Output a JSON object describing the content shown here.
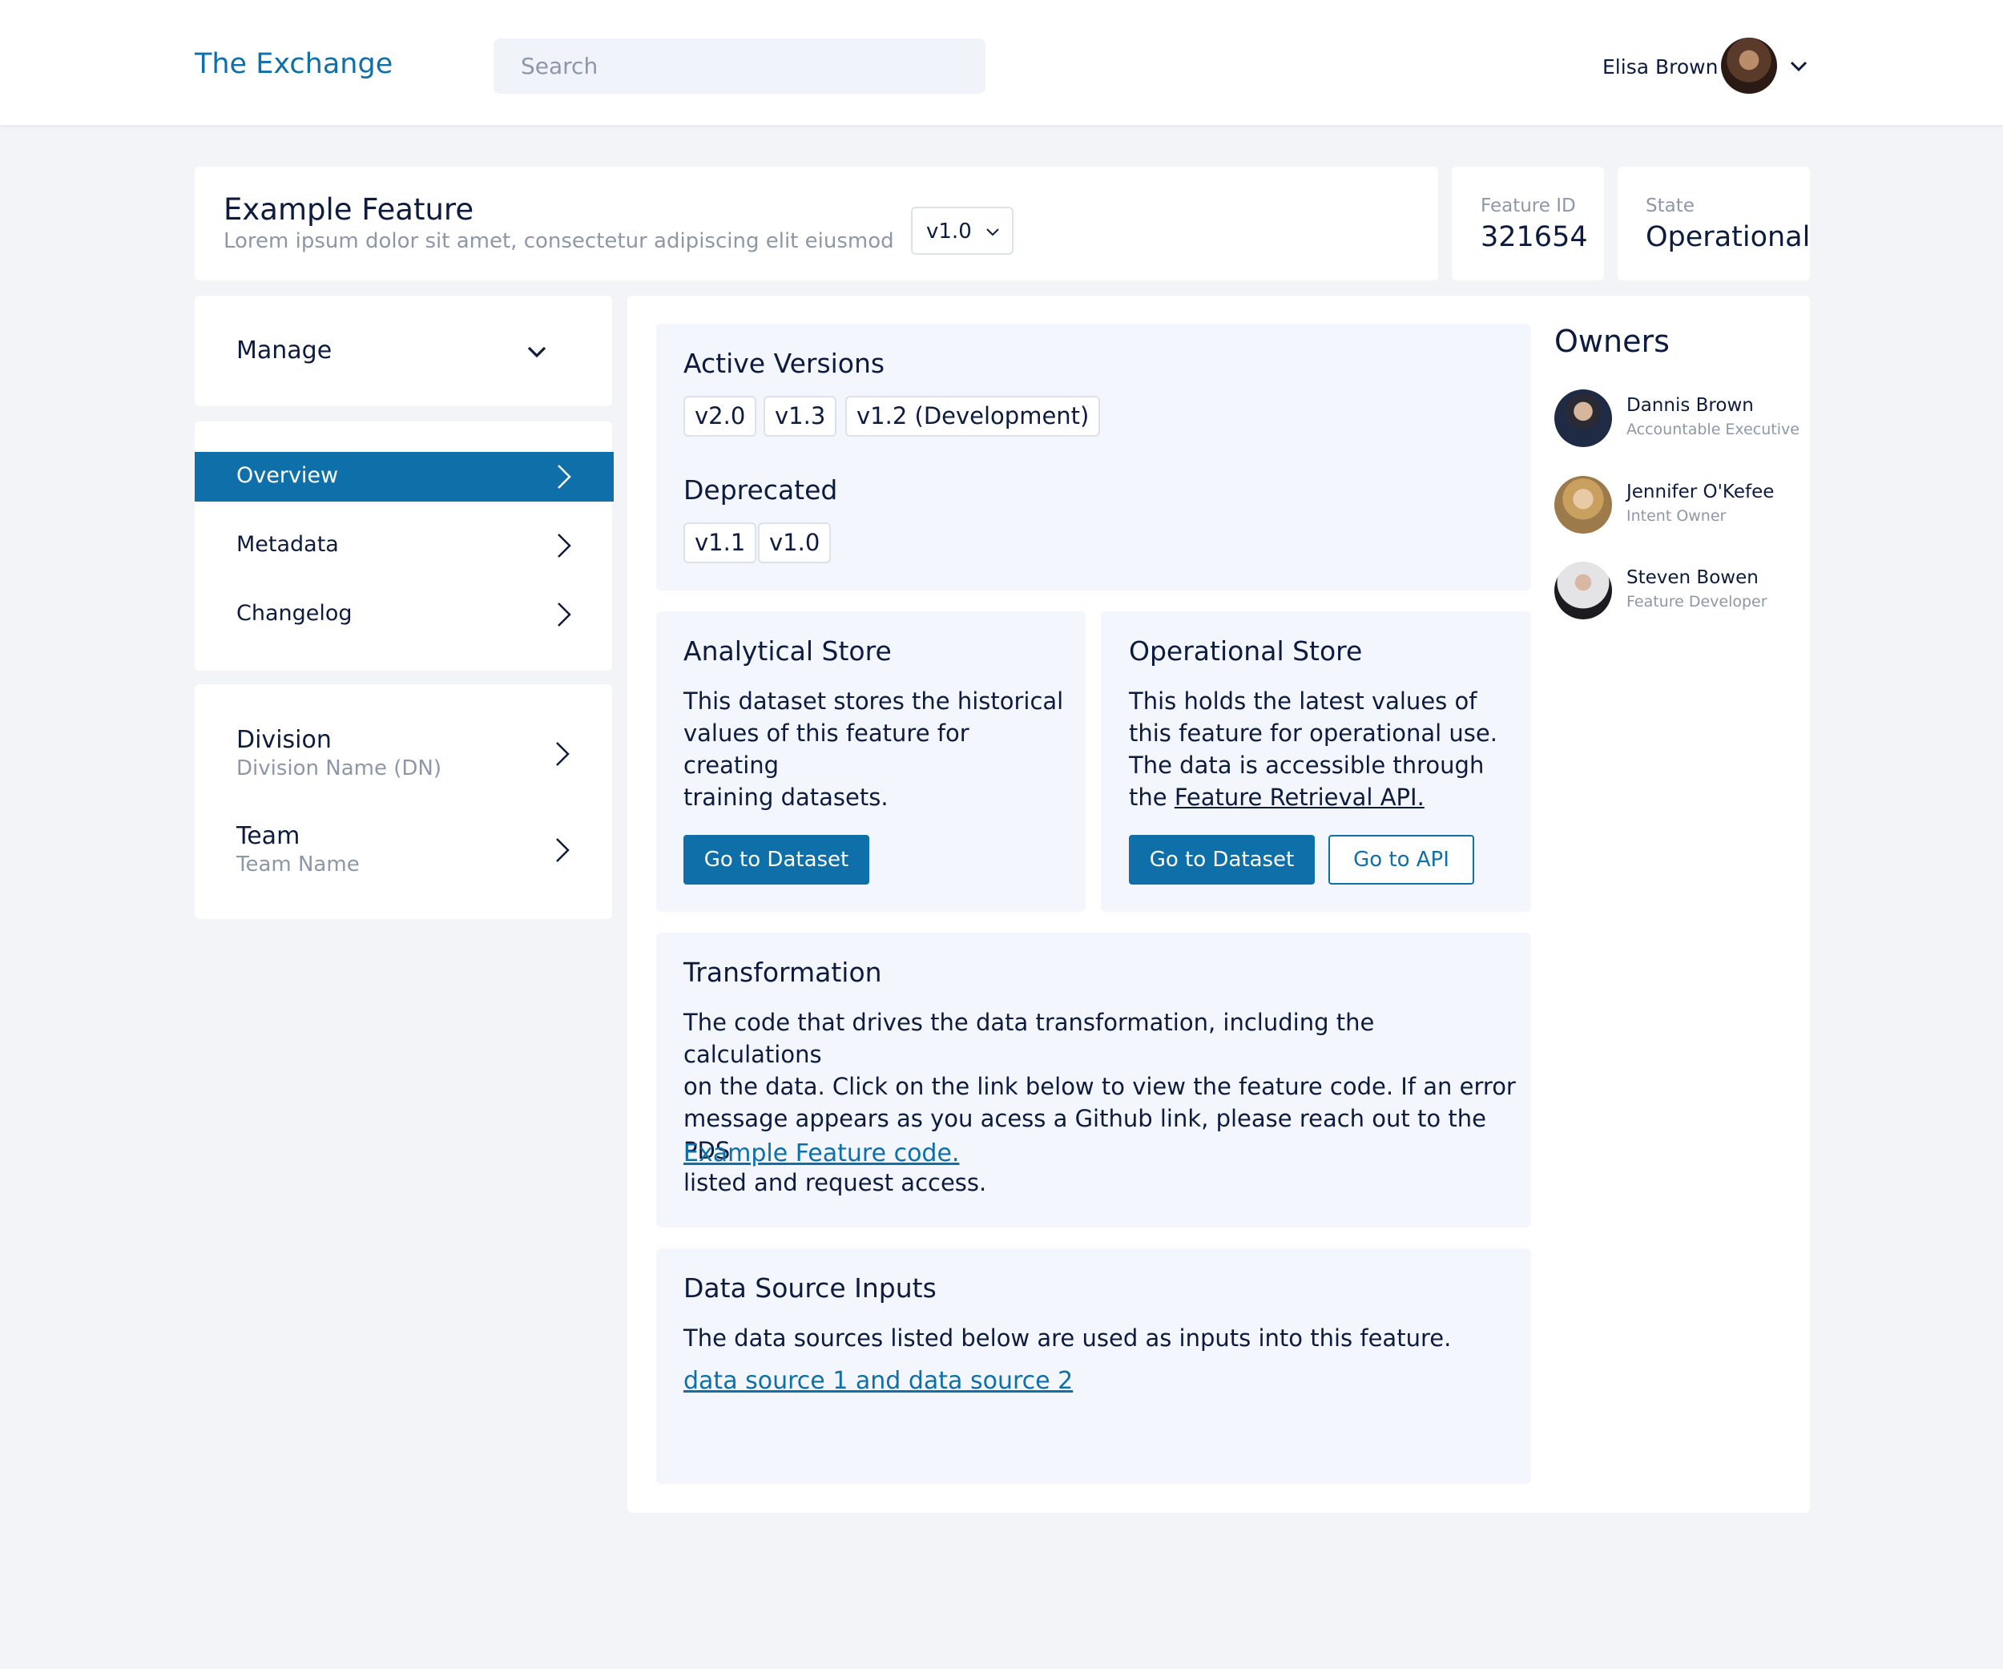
{
  "header": {
    "brand": "The Exchange",
    "search_placeholder": "Search",
    "user_name": "Elisa Brown"
  },
  "feature": {
    "title": "Example Feature",
    "subtitle": "Lorem ipsum dolor sit amet, consectetur adipiscing elit eiusmod",
    "selected_version": "v1.0",
    "id_label": "Feature ID",
    "id_value": "321654",
    "state_label": "State",
    "state_value": "Operational"
  },
  "sidebar": {
    "manage_label": "Manage",
    "nav_items": [
      {
        "label": "Overview",
        "active": true
      },
      {
        "label": "Metadata",
        "active": false
      },
      {
        "label": "Changelog",
        "active": false
      }
    ],
    "org_items": [
      {
        "title": "Division",
        "subtitle": "Division Name (DN)"
      },
      {
        "title": "Team",
        "subtitle": "Team Name"
      }
    ]
  },
  "versions": {
    "active_title": "Active Versions",
    "active": [
      "v2.0",
      "v1.3",
      "v1.2 (Development)"
    ],
    "deprecated_title": "Deprecated",
    "deprecated": [
      "v1.1",
      "v1.0"
    ]
  },
  "analytical_store": {
    "title": "Analytical Store",
    "line1": "This dataset stores the historical",
    "line2": "values of this feature for creating",
    "line3": "training datasets.",
    "button": "Go to Dataset"
  },
  "operational_store": {
    "title": "Operational Store",
    "line1": "This holds the latest values of",
    "line2": "this feature for operational use.",
    "line3": "The data is accessible through",
    "line4_prefix": "the ",
    "line4_link": "Feature Retrieval API.",
    "button_dataset": "Go to Dataset",
    "button_api": "Go to API"
  },
  "transformation": {
    "title": "Transformation",
    "line1": "The code that drives the data transformation, including the calculations",
    "line2": "on the data. Click on the link below to view the feature code. If an error",
    "line3": "message appears as you acess a Github link, please reach out to the PDS",
    "line4": "listed and request access.",
    "link": "Example Feature code."
  },
  "data_sources": {
    "title": "Data Source Inputs",
    "text": "The data sources listed below are used as inputs into this feature.",
    "link": "data source 1 and data source 2"
  },
  "owners": {
    "title": "Owners",
    "list": [
      {
        "name": "Dannis Brown",
        "role": "Accountable Executive"
      },
      {
        "name": "Jennifer O'Kefee",
        "role": "Intent Owner"
      },
      {
        "name": "Steven Bowen",
        "role": "Feature Developer"
      }
    ]
  },
  "colors": {
    "accent": "#0f6fa8",
    "page_bg": "#f3f4f8",
    "card_bg": "#f3f6fc",
    "text": "#0d1b3e",
    "muted": "#8d97a8"
  }
}
